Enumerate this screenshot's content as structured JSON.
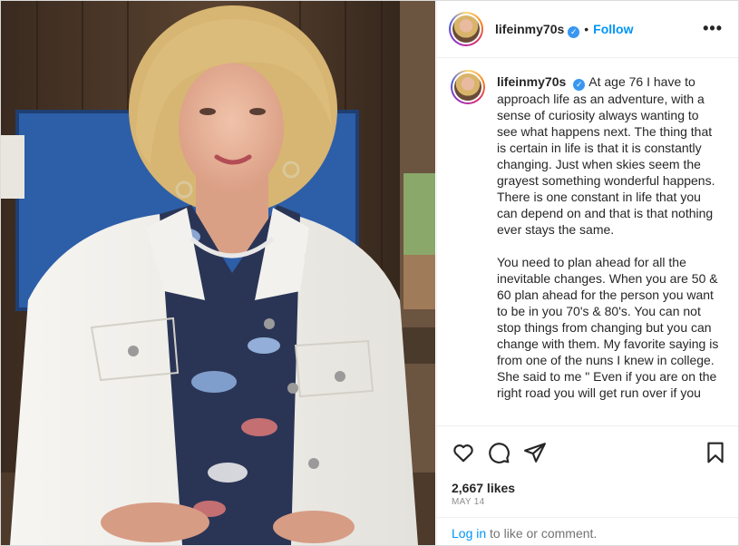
{
  "post": {
    "username": "lifeinmy70s",
    "verified_mark": "✓",
    "separator": "•",
    "follow_label": "Follow",
    "more_label": "•••",
    "caption_paragraphs": [
      "At age 76 I have to approach life as an adventure, with a sense of curiosity always wanting to see what happens next. The thing that is certain in life is that it is constantly changing. Just when skies seem the grayest something wonderful happens. There is one constant in life that you can depend on and that is that nothing ever stays the same.",
      "You need to plan ahead for all the inevitable changes. When you are 50 & 60 plan ahead for the person you want to be in you 70's & 80's. You can not stop things from changing but you can change with them. My favorite saying is from one of the nuns I knew in college. She said to me \" Even if you are on the right road you will get run over if you"
    ],
    "likes": "2,667 likes",
    "date": "MAY 14",
    "login_link": "Log in",
    "login_text": " to like or comment."
  },
  "icons": {
    "like": "heart-icon",
    "comment": "comment-icon",
    "share": "share-icon",
    "save": "bookmark-icon",
    "more": "more-icon"
  },
  "colors": {
    "link_blue": "#0095f6",
    "verified_blue": "#3897f0",
    "text": "#262626",
    "muted": "#8e8e8e"
  }
}
